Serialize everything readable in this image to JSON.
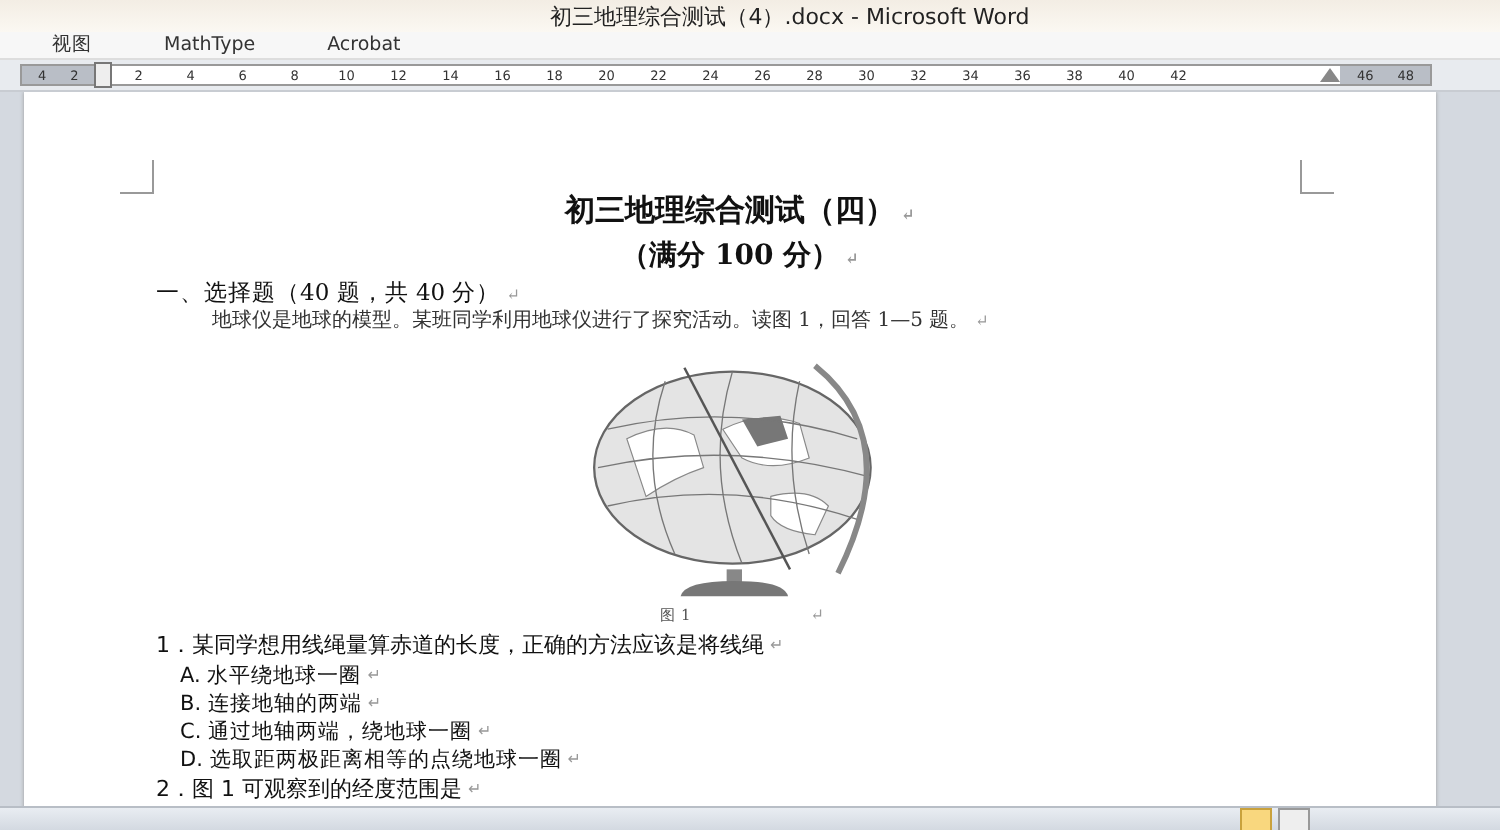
{
  "window": {
    "title": "初三地理综合测试（4）.docx  -  Microsoft Word"
  },
  "menu": [
    {
      "label": "视图"
    },
    {
      "label": "MathType"
    },
    {
      "label": "Acrobat"
    }
  ],
  "ruler": {
    "left_numbers": [
      "4",
      "2"
    ],
    "numbers": [
      "2",
      "4",
      "6",
      "8",
      "10",
      "12",
      "14",
      "16",
      "18",
      "20",
      "22",
      "24",
      "26",
      "28",
      "30",
      "32",
      "34",
      "36",
      "38",
      "40",
      "42"
    ],
    "right_numbers": [
      "46",
      "48"
    ]
  },
  "document": {
    "paragraphs": [
      {
        "kind": "title",
        "text": "初三地理综合测试（四）",
        "mark": "↵"
      },
      {
        "kind": "subtitle",
        "text": "（满分 100 分）",
        "mark": "↵"
      },
      {
        "kind": "section",
        "text": "一、选择题（40 题，共 40 分）",
        "mark": "↵"
      },
      {
        "kind": "intro",
        "text": "地球仪是地球的模型。某班同学利用地球仪进行了探究活动。读图 1，回答 1—5 题。",
        "mark": "↵"
      },
      {
        "kind": "figure",
        "caption": "图 1",
        "mark": "↵"
      },
      {
        "kind": "question",
        "text": "1．某同学想用线绳量算赤道的长度，正确的方法应该是将线绳",
        "mark": "↵"
      },
      {
        "kind": "option",
        "text": "A. 水平绕地球一圈",
        "mark": "↵"
      },
      {
        "kind": "option",
        "text": "B. 连接地轴的两端",
        "mark": "↵"
      },
      {
        "kind": "option",
        "text": "C. 通过地轴两端，绕地球一圈",
        "mark": "↵"
      },
      {
        "kind": "option",
        "text": "D. 选取距两极距离相等的点绕地球一圈",
        "mark": "↵"
      },
      {
        "kind": "question",
        "text": "2．图 1 可观察到的经度范围是",
        "mark": "↵"
      }
    ]
  }
}
